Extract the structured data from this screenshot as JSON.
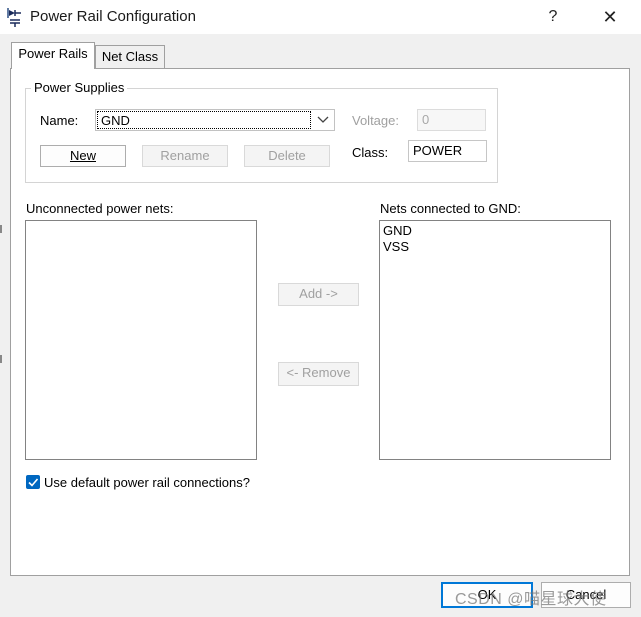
{
  "window": {
    "title": "Power Rail Configuration",
    "help_label": "?",
    "close_label": "✕"
  },
  "tabs": [
    {
      "label": "Power Rails",
      "active": true
    },
    {
      "label": "Net Class",
      "active": false
    }
  ],
  "power_supplies": {
    "group_label": "Power Supplies",
    "name_label": "Name:",
    "name_value": "GND",
    "voltage_label": "Voltage:",
    "voltage_value": "0",
    "class_label": "Class:",
    "class_value": "POWER",
    "new_label": "New",
    "rename_label": "Rename",
    "delete_label": "Delete"
  },
  "unconnected": {
    "label": "Unconnected power nets:",
    "items": []
  },
  "connected": {
    "label": "Nets connected to GND:",
    "items": [
      "GND",
      "VSS"
    ]
  },
  "add_label": "Add ->",
  "remove_label": "<- Remove",
  "default_connections": {
    "label": "Use default power rail connections?",
    "checked": true
  },
  "footer": {
    "ok_label": "OK",
    "cancel_label": "Cancel"
  },
  "watermark": "CSDN @喵星球大使",
  "colors": {
    "accent": "#0078d7",
    "checkbox": "#0067c0"
  }
}
